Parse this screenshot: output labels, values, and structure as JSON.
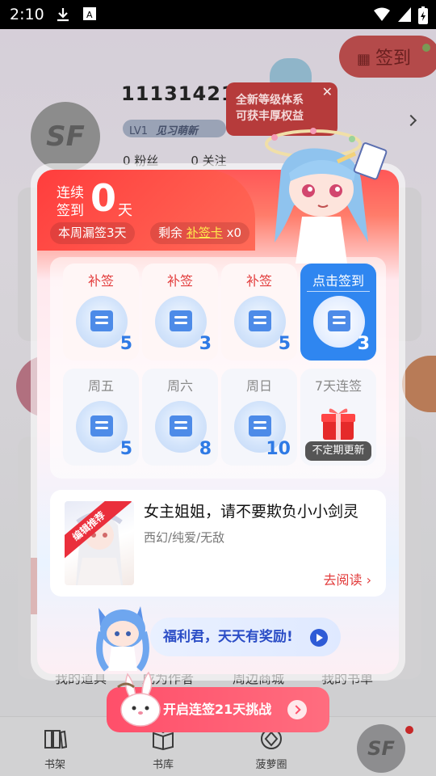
{
  "status_bar": {
    "time": "2:10"
  },
  "background": {
    "signin_label": "签到",
    "avatar_text": "SF",
    "user_id": "11131421",
    "level": "LV1",
    "level_name": "见习萌新",
    "stats": [
      "0 粉丝",
      "0 关注"
    ],
    "tip": [
      "全新等级体系",
      "可获丰厚权益"
    ],
    "quick_links": [
      "我的道具",
      "成为作者",
      "周边商城",
      "我的书单"
    ],
    "nav": [
      {
        "label": "书架",
        "icon": "bookshelf-icon"
      },
      {
        "label": "书库",
        "icon": "book-icon"
      },
      {
        "label": "菠萝圈",
        "icon": "pineapple-icon"
      }
    ],
    "nav_sf": "SF"
  },
  "modal": {
    "streak_prefix": "连续签到",
    "streak_count": "0",
    "streak_suffix": "天",
    "missed": "本周漏签3天",
    "cards_prefix": "剩余",
    "cards_link": "补签卡",
    "cards_count": "x0",
    "days": [
      {
        "label": "补签",
        "count": "5"
      },
      {
        "label": "补签",
        "count": "3"
      },
      {
        "label": "补签",
        "count": "5"
      },
      {
        "label": "点击签到",
        "count": "3"
      },
      {
        "label": "周五",
        "count": "5"
      },
      {
        "label": "周六",
        "count": "8"
      },
      {
        "label": "周日",
        "count": "10"
      },
      {
        "label": "7天连签",
        "note": "不定期更新"
      }
    ],
    "recommend": {
      "badge": "编辑推荐",
      "title": "女主姐姐，请不要欺负小小剑灵",
      "tags": "西幻/纯爱/无敌",
      "action": "去阅读"
    },
    "welfare": "福利君，天天有奖励!",
    "challenge": "开启连签21天挑战"
  },
  "colors": {
    "accent_red": "#ff4f4f",
    "accent_blue": "#2f86f0"
  }
}
